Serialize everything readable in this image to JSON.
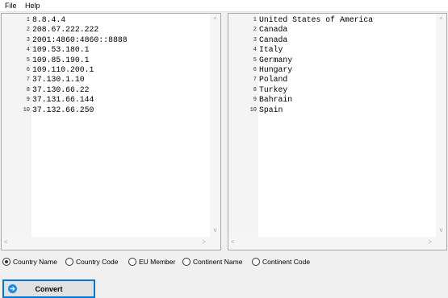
{
  "menu": {
    "file": "File",
    "help": "Help"
  },
  "input_editor": {
    "lines": [
      {
        "num": "1",
        "text": "8.8.4.4"
      },
      {
        "num": "2",
        "text": "208.67.222.222"
      },
      {
        "num": "3",
        "text": "2001:4860:4860::8888"
      },
      {
        "num": "4",
        "text": "109.53.180.1"
      },
      {
        "num": "5",
        "text": "109.85.190.1"
      },
      {
        "num": "6",
        "text": "109.110.200.1"
      },
      {
        "num": "7",
        "text": "37.130.1.10"
      },
      {
        "num": "8",
        "text": "37.130.66.22"
      },
      {
        "num": "9",
        "text": "37.131.66.144"
      },
      {
        "num": "10",
        "text": "37.132.66.250"
      }
    ]
  },
  "output_editor": {
    "lines": [
      {
        "num": "1",
        "text": "United States of America"
      },
      {
        "num": "2",
        "text": "Canada"
      },
      {
        "num": "3",
        "text": "Canada"
      },
      {
        "num": "4",
        "text": "Italy"
      },
      {
        "num": "5",
        "text": "Germany"
      },
      {
        "num": "6",
        "text": "Hungary"
      },
      {
        "num": "7",
        "text": "Poland"
      },
      {
        "num": "8",
        "text": "Turkey"
      },
      {
        "num": "9",
        "text": "Bahrain"
      },
      {
        "num": "10",
        "text": "Spain"
      }
    ]
  },
  "scroll": {
    "up": "^",
    "down": "v",
    "left": "<",
    "right": ">"
  },
  "options": [
    {
      "label": "Country Name",
      "checked": true
    },
    {
      "label": "Country Code",
      "checked": false
    },
    {
      "label": "EU Member",
      "checked": false
    },
    {
      "label": "Continent Name",
      "checked": false
    },
    {
      "label": "Continent Code",
      "checked": false
    }
  ],
  "convert": {
    "label": "Convert",
    "icon": "arrow-right-circle-icon",
    "icon_glyph": "➔"
  },
  "colors": {
    "accent": "#0078d7",
    "icon_blue": "#1e88e5",
    "gutter_bg": "#f4f4f4",
    "window_bg": "#f0f0f0"
  }
}
